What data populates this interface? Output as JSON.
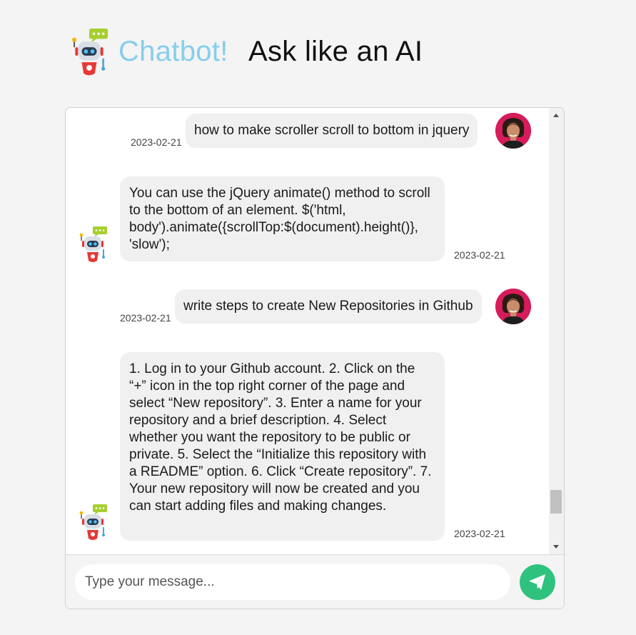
{
  "header": {
    "title_accent": "Chatbot!",
    "title_main": "Ask like an AI"
  },
  "colors": {
    "accent": "#87ceeb",
    "send_button": "#2ec27e",
    "user_avatar_bg": "#d61c5a",
    "bubble_bg": "#f0f0f0"
  },
  "icons": {
    "logo": "robot-icon",
    "bot_avatar": "robot-icon",
    "user_avatar": "person-avatar",
    "send": "paper-plane-icon"
  },
  "messages": [
    {
      "role": "user",
      "text": "how to make scroller scroll to bottom in jquery",
      "date": "2023-02-21"
    },
    {
      "role": "bot",
      "text": "You can use the jQuery animate() method to scroll to the bottom of an element. $('html, body').animate({scrollTop:$(document).height()}, 'slow');",
      "date": "2023-02-21"
    },
    {
      "role": "user",
      "text": "write steps to create New Repositories in Github",
      "date": "2023-02-21"
    },
    {
      "role": "bot",
      "text": "1. Log in to your Github account. 2. Click on the “+” icon in the top right corner of the page and select “New repository”. 3. Enter a name for your repository and a brief description. 4. Select whether you want the repository to be public or private. 5. Select the “Initialize this repository with a README” option. 6. Click “Create repository”. 7. Your new repository will now be created and you can start adding files and making changes.",
      "date": "2023-02-21"
    }
  ],
  "input": {
    "placeholder": "Type your message...",
    "value": ""
  }
}
